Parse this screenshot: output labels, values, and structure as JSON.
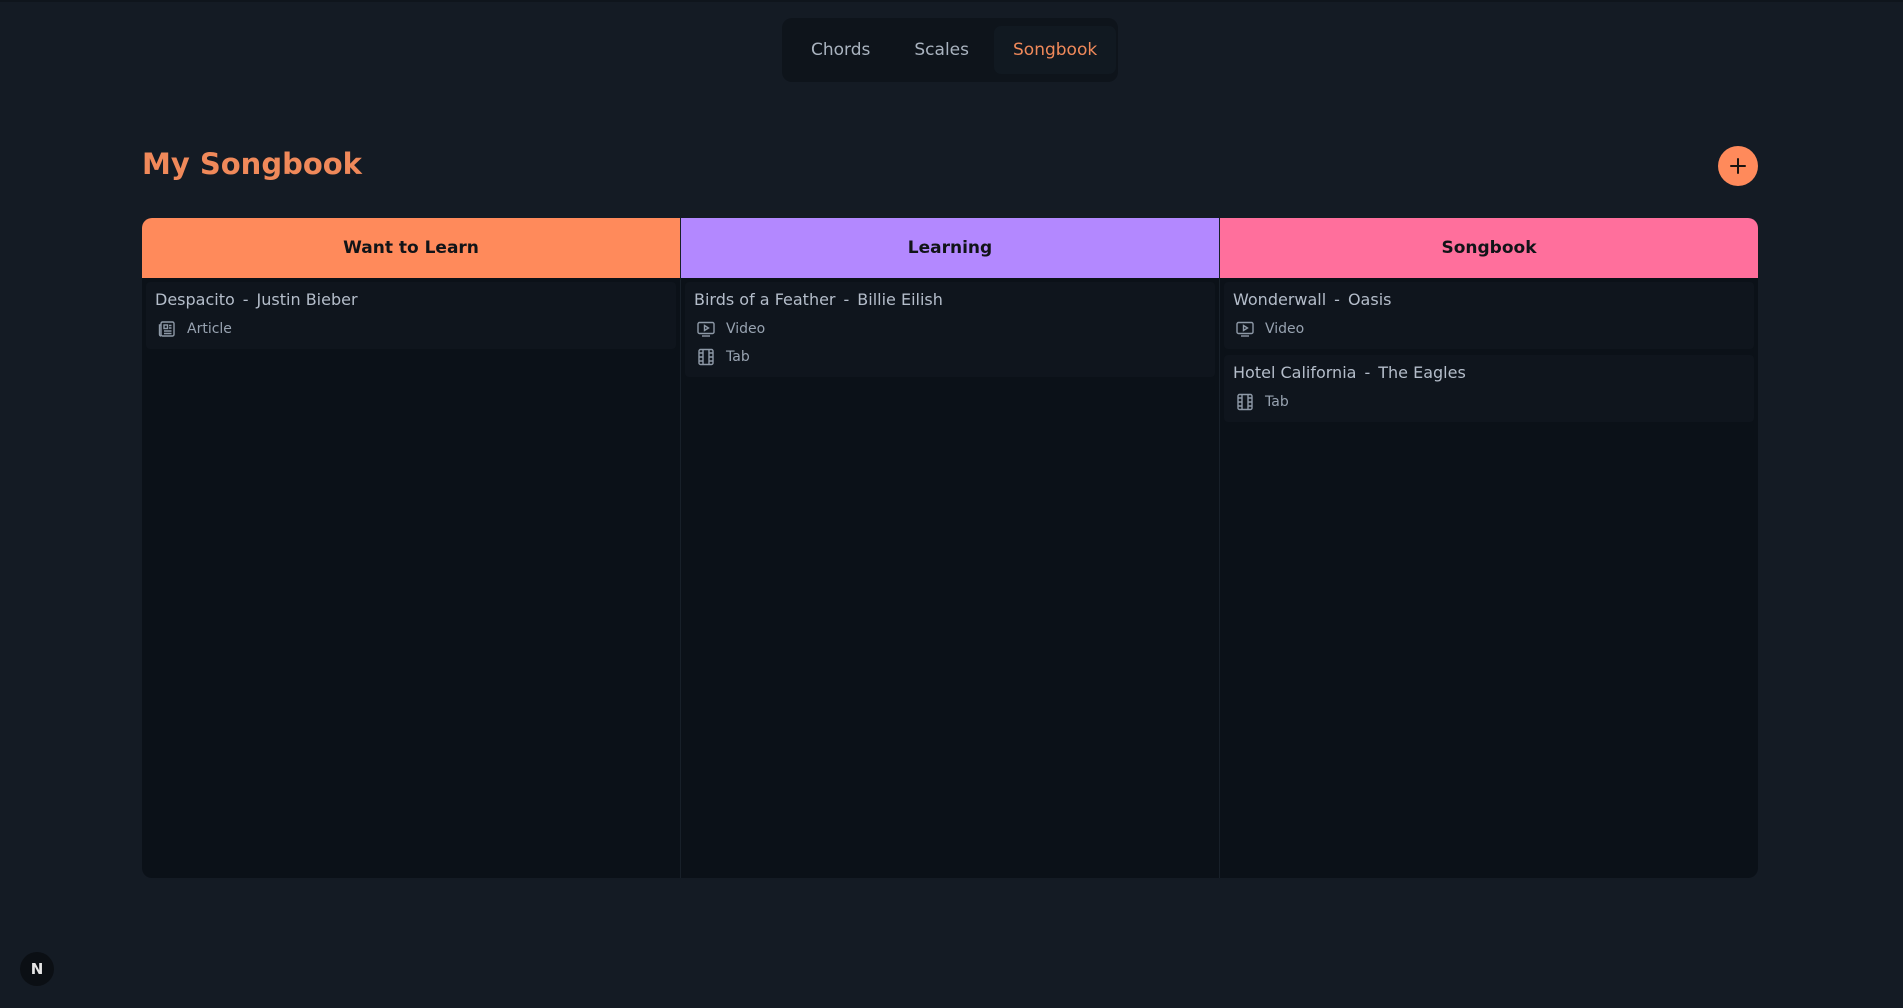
{
  "nav": {
    "tabs": [
      {
        "label": "Chords",
        "active": false
      },
      {
        "label": "Scales",
        "active": false
      },
      {
        "label": "Songbook",
        "active": true
      }
    ]
  },
  "header": {
    "title": "My Songbook",
    "add_icon": "plus-icon"
  },
  "colors": {
    "accent": "#ff8a5b",
    "want_to_learn": "#ff8a5b",
    "learning": "#b388ff",
    "songbook": "#ff6f9c"
  },
  "columns": [
    {
      "title": "Want to Learn",
      "cards": [
        {
          "song": "Despacito",
          "separator": "-",
          "artist": "Justin Bieber",
          "resources": [
            {
              "type": "Article",
              "icon": "article-icon"
            }
          ]
        }
      ]
    },
    {
      "title": "Learning",
      "cards": [
        {
          "song": "Birds of a Feather",
          "separator": "-",
          "artist": "Billie Eilish",
          "resources": [
            {
              "type": "Video",
              "icon": "video-icon"
            },
            {
              "type": "Tab",
              "icon": "tab-icon"
            }
          ]
        }
      ]
    },
    {
      "title": "Songbook",
      "cards": [
        {
          "song": "Wonderwall",
          "separator": "-",
          "artist": "Oasis",
          "resources": [
            {
              "type": "Video",
              "icon": "video-icon"
            }
          ]
        },
        {
          "song": "Hotel California",
          "separator": "-",
          "artist": "The Eagles",
          "resources": [
            {
              "type": "Tab",
              "icon": "tab-icon"
            }
          ]
        }
      ]
    }
  ],
  "corner_badge": {
    "label": "N",
    "icon": "nextjs-icon"
  }
}
